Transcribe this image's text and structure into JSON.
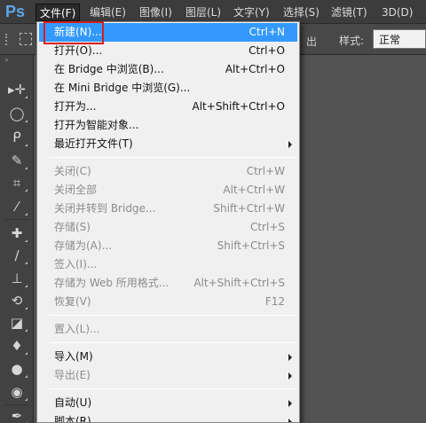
{
  "app": {
    "logo": "Ps"
  },
  "menubar": {
    "items": [
      {
        "label": "文件(F)"
      },
      {
        "label": "编辑(E)"
      },
      {
        "label": "图像(I)"
      },
      {
        "label": "图层(L)"
      },
      {
        "label": "文字(Y)"
      },
      {
        "label": "选择(S)"
      },
      {
        "label": "滤镜(T)"
      },
      {
        "label": "3D(D)"
      }
    ]
  },
  "options_bar": {
    "partial_text": "出",
    "style_label": "样式:",
    "style_value": "正常"
  },
  "toolbar": {
    "tools": [
      {
        "icon": "move-tool-icon",
        "glyph": "▸✛"
      },
      {
        "icon": "ellipse-marquee-icon",
        "glyph": "◯"
      },
      {
        "icon": "lasso-icon",
        "glyph": "ᑭ"
      },
      {
        "icon": "quick-select-icon",
        "glyph": "✎"
      },
      {
        "icon": "crop-icon",
        "glyph": "⌗"
      },
      {
        "icon": "eyedropper-icon",
        "glyph": "⁄"
      },
      {
        "icon": "healing-brush-icon",
        "glyph": "✚"
      },
      {
        "icon": "brush-icon",
        "glyph": "∕"
      },
      {
        "icon": "stamp-icon",
        "glyph": "⊥"
      },
      {
        "icon": "history-brush-icon",
        "glyph": "⟲"
      },
      {
        "icon": "eraser-icon",
        "glyph": "◪"
      },
      {
        "icon": "paint-bucket-icon",
        "glyph": "♦"
      },
      {
        "icon": "blur-icon",
        "glyph": "●"
      },
      {
        "icon": "dodge-icon",
        "glyph": "◉"
      },
      {
        "icon": "pen-icon",
        "glyph": "✒"
      }
    ]
  },
  "file_menu": {
    "items": [
      {
        "label": "新建(N)...",
        "shortcut": "Ctrl+N",
        "enabled": true,
        "highlighted": true
      },
      {
        "label": "打开(O)...",
        "shortcut": "Ctrl+O",
        "enabled": true
      },
      {
        "label": "在 Bridge 中浏览(B)...",
        "shortcut": "Alt+Ctrl+O",
        "enabled": true
      },
      {
        "label": "在 Mini Bridge 中浏览(G)...",
        "shortcut": "",
        "enabled": true
      },
      {
        "label": "打开为...",
        "shortcut": "Alt+Shift+Ctrl+O",
        "enabled": true
      },
      {
        "label": "打开为智能对象...",
        "shortcut": "",
        "enabled": true
      },
      {
        "label": "最近打开文件(T)",
        "shortcut": "",
        "enabled": true,
        "submenu": true
      },
      {
        "separator": true
      },
      {
        "label": "关闭(C)",
        "shortcut": "Ctrl+W",
        "enabled": false
      },
      {
        "label": "关闭全部",
        "shortcut": "Alt+Ctrl+W",
        "enabled": false
      },
      {
        "label": "关闭并转到 Bridge...",
        "shortcut": "Shift+Ctrl+W",
        "enabled": false
      },
      {
        "label": "存储(S)",
        "shortcut": "Ctrl+S",
        "enabled": false
      },
      {
        "label": "存储为(A)...",
        "shortcut": "Shift+Ctrl+S",
        "enabled": false
      },
      {
        "label": "签入(I)...",
        "shortcut": "",
        "enabled": false
      },
      {
        "label": "存储为 Web 所用格式...",
        "shortcut": "Alt+Shift+Ctrl+S",
        "enabled": false
      },
      {
        "label": "恢复(V)",
        "shortcut": "F12",
        "enabled": false
      },
      {
        "separator": true
      },
      {
        "label": "置入(L)...",
        "shortcut": "",
        "enabled": false
      },
      {
        "separator": true
      },
      {
        "label": "导入(M)",
        "shortcut": "",
        "enabled": true,
        "submenu": true
      },
      {
        "label": "导出(E)",
        "shortcut": "",
        "enabled": false,
        "submenu": true
      },
      {
        "separator": true
      },
      {
        "label": "自动(U)",
        "shortcut": "",
        "enabled": true,
        "submenu": true
      },
      {
        "label": "脚本(R)",
        "shortcut": "",
        "enabled": true,
        "submenu": true
      }
    ]
  }
}
